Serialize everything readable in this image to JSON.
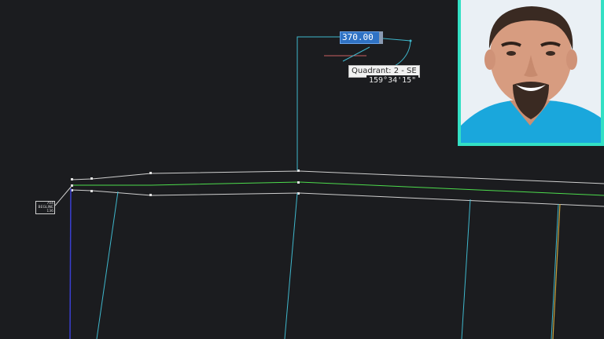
{
  "dimension_input": {
    "value": "370.00"
  },
  "tooltip": {
    "quadrant_text": "Quadrant: 2 - SE",
    "angle_text": "159°34'15\""
  },
  "baseline_tag": {
    "line1": "704",
    "line2": "BEGLINE",
    "line3": "136"
  },
  "colors": {
    "background": "#1b1c1f",
    "alignment_cyan": "#3fb7cc",
    "baseline_green": "#4ddc4d",
    "road_edge_white": "#d6d6d6",
    "offset_orange": "#c9a23d",
    "webcam_border": "#33e0c4",
    "shirt_blue": "#1aa7dc"
  },
  "webcam": {
    "icon": "presenter-portrait"
  }
}
